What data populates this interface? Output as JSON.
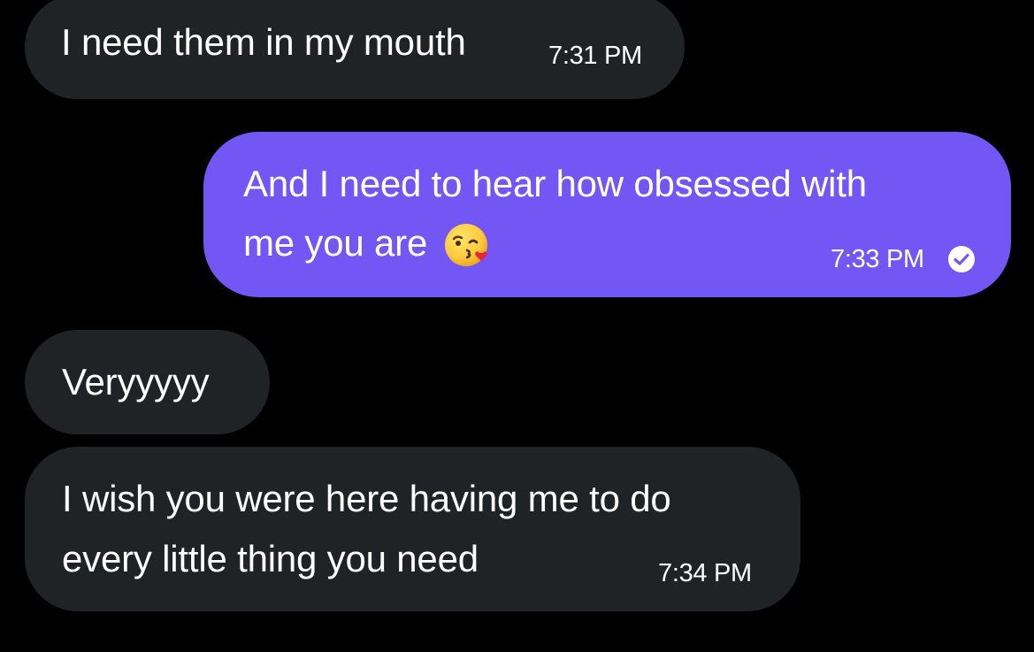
{
  "colors": {
    "background": "#000000",
    "incoming_bubble": "#202326",
    "outgoing_bubble": "#7257f5",
    "text": "#ffffff"
  },
  "messages": [
    {
      "direction": "incoming",
      "lines": [
        "I need them in my mouth"
      ],
      "time": "7:31 PM"
    },
    {
      "direction": "outgoing",
      "lines": [
        "And I need to hear how obsessed with",
        "me you are"
      ],
      "emoji": "face-blowing-a-kiss",
      "time": "7:33 PM",
      "status_icon": "read-check-icon"
    },
    {
      "direction": "incoming",
      "lines": [
        "Veryyyyy"
      ]
    },
    {
      "direction": "incoming",
      "lines": [
        "I wish you were here having me to do",
        "every little thing you need"
      ],
      "time": "7:34 PM"
    }
  ]
}
